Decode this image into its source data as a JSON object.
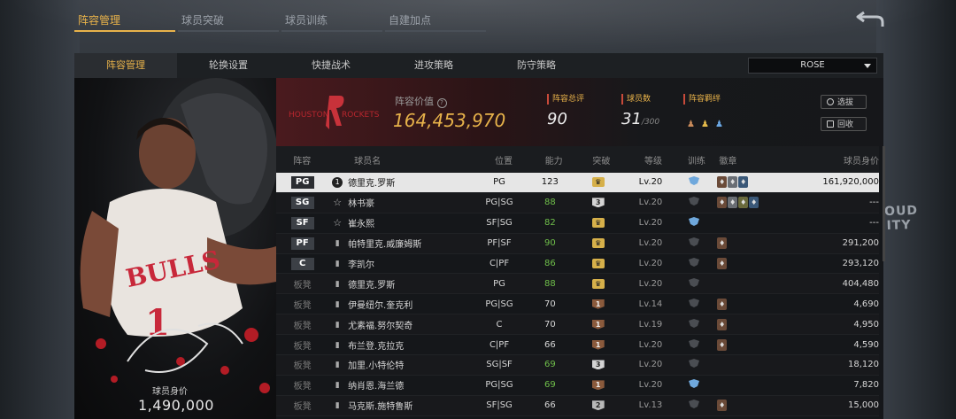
{
  "top_tabs": [
    "阵容管理",
    "球员突破",
    "球员训练",
    "自建加点"
  ],
  "sub_tabs": [
    "阵容管理",
    "轮换设置",
    "快捷战术",
    "进攻策略",
    "防守策略"
  ],
  "player_select": "ROSE",
  "arena_banner": "LOUD CITY",
  "portrait": {
    "label": "球员身价",
    "value": "1,490,000"
  },
  "team": {
    "logo_text": [
      "HOUSTON",
      "ROCKETS"
    ],
    "value_title": "阵容价值",
    "value": "164,453,970",
    "stats": [
      {
        "tag": "阵容总评",
        "value": "90",
        "suffix": ""
      },
      {
        "tag": "球员数",
        "value": "31",
        "suffix": "/300"
      },
      {
        "tag": "阵容羁绊",
        "value": "",
        "suffix": ""
      }
    ],
    "buttons": [
      "选拔",
      "回收"
    ]
  },
  "table": {
    "headers": [
      "阵容",
      "球员名",
      "位置",
      "能力",
      "突破",
      "等级",
      "训练",
      "徽章",
      "球员身价"
    ],
    "rows": [
      {
        "lineup": "PG",
        "name": "德里克.罗斯",
        "pos": "PG",
        "ability": "123",
        "level": "Lv.20",
        "value": "161,920,000"
      },
      {
        "lineup": "SG",
        "name": "林书豪",
        "pos": "PG|SG",
        "ability": "88",
        "level": "Lv.20",
        "value": "---"
      },
      {
        "lineup": "SF",
        "name": "崔永熙",
        "pos": "SF|SG",
        "ability": "82",
        "level": "Lv.20",
        "value": "---"
      },
      {
        "lineup": "PF",
        "name": "帕特里克.威廉姆斯",
        "pos": "PF|SF",
        "ability": "90",
        "level": "Lv.20",
        "value": "291,200"
      },
      {
        "lineup": "C",
        "name": "李凯尔",
        "pos": "C|PF",
        "ability": "86",
        "level": "Lv.20",
        "value": "293,120"
      },
      {
        "lineup": "板凳",
        "name": "德里克.罗斯",
        "pos": "PG",
        "ability": "88",
        "level": "Lv.20",
        "value": "404,480"
      },
      {
        "lineup": "板凳",
        "name": "伊曼纽尔.奎克利",
        "pos": "PG|SG",
        "ability": "70",
        "level": "Lv.14",
        "value": "4,690"
      },
      {
        "lineup": "板凳",
        "name": "尤素福.努尔契奇",
        "pos": "C",
        "ability": "70",
        "level": "Lv.19",
        "value": "4,950"
      },
      {
        "lineup": "板凳",
        "name": "布兰登.克拉克",
        "pos": "C|PF",
        "ability": "66",
        "level": "Lv.20",
        "value": "4,590"
      },
      {
        "lineup": "板凳",
        "name": "加里.小特伦特",
        "pos": "SG|SF",
        "ability": "69",
        "level": "Lv.20",
        "value": "18,120"
      },
      {
        "lineup": "板凳",
        "name": "纳肖恩.海兰德",
        "pos": "PG|SG",
        "ability": "69",
        "level": "Lv.20",
        "value": "7,820"
      },
      {
        "lineup": "板凳",
        "name": "马克斯.施特鲁斯",
        "pos": "SF|SG",
        "ability": "66",
        "level": "Lv.13",
        "value": "15,000"
      }
    ]
  },
  "colors": {
    "accent": "#e8b24a",
    "green_ability": "#6fbf4a",
    "rockets_red": "#c8323a"
  }
}
